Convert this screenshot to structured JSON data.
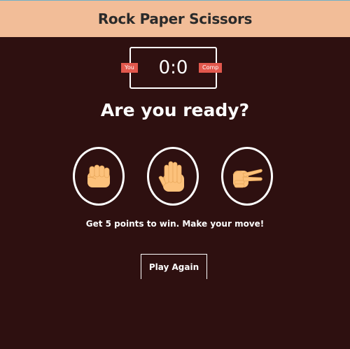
{
  "header": {
    "title": "Rock Paper Scissors"
  },
  "score": {
    "user_label": "You",
    "comp_label": "Comp",
    "display": "0:0"
  },
  "result": {
    "text": "Are you ready?"
  },
  "choices": [
    {
      "id": "rock",
      "icon": "fist-icon"
    },
    {
      "id": "paper",
      "icon": "open-hand-icon"
    },
    {
      "id": "scissors",
      "icon": "scissors-hand-icon"
    }
  ],
  "message": {
    "text": "Get 5 points to win. Make your move!"
  },
  "actions": {
    "play_again_label": "Play Again"
  },
  "colors": {
    "background": "#2e1010",
    "header": "#f2bd98",
    "badge": "#e2584d",
    "skin": "#fcc17b",
    "skin_shadow": "#e8a75a"
  }
}
